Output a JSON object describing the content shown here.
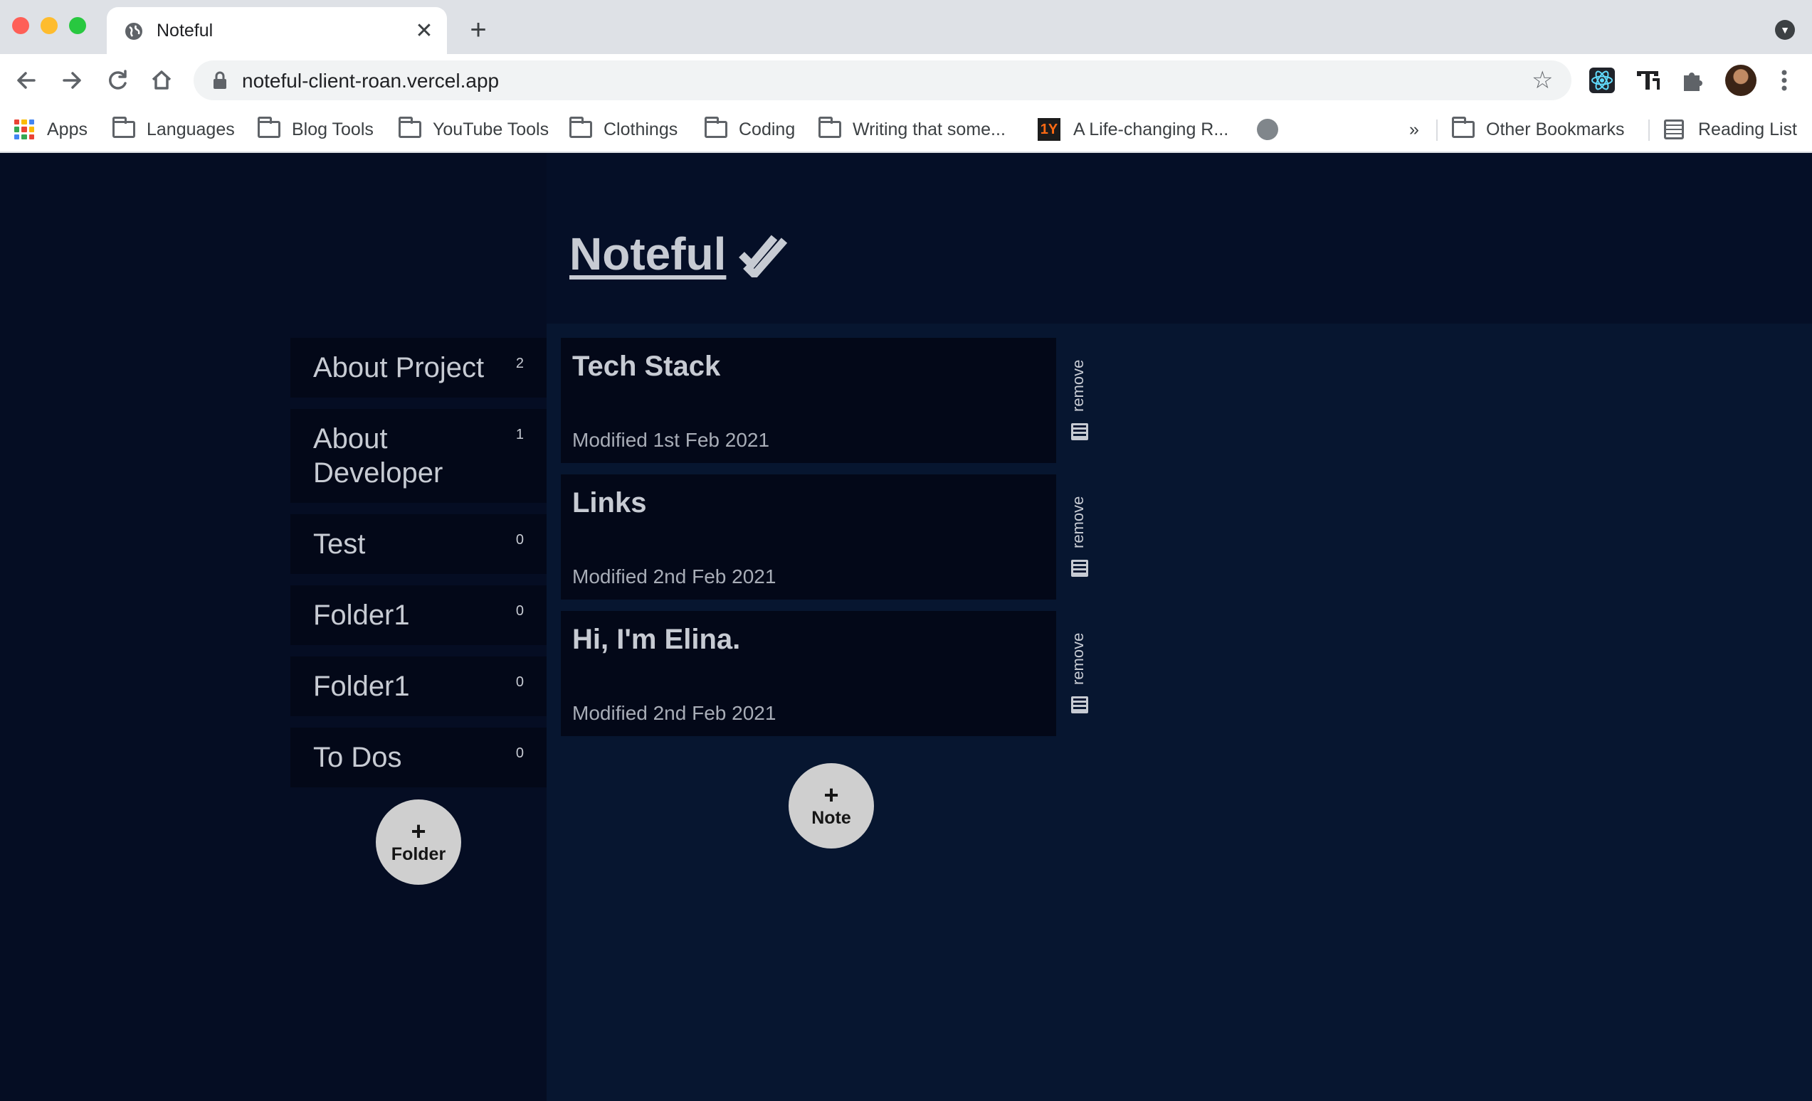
{
  "browser": {
    "tab_title": "Noteful",
    "tab_close": "✕",
    "new_tab": "+",
    "url": "noteful-client-roan.vercel.app",
    "icons": {
      "tab_favicon": "globe-icon",
      "back": "arrow-left-icon",
      "forward": "arrow-right-icon",
      "reload": "reload-icon",
      "home": "home-icon",
      "lock": "lock-icon",
      "bookmark_star": "star-icon",
      "react_devtools": "react-icon",
      "text_extension": "text-extension-icon",
      "extensions": "puzzle-icon",
      "profile": "avatar",
      "menu": "kebab-menu-icon"
    }
  },
  "bookmarks": {
    "items": [
      {
        "label": "Apps"
      },
      {
        "label": "Languages"
      },
      {
        "label": "Blog Tools"
      },
      {
        "label": "YouTube Tools"
      },
      {
        "label": "Clothings"
      },
      {
        "label": "Coding"
      },
      {
        "label": "Writing that some..."
      },
      {
        "label": "A Life-changing R..."
      }
    ],
    "overflow": "»",
    "other": "Other Bookmarks",
    "reading_list": "Reading List",
    "oneyear_badge": "1Y"
  },
  "app": {
    "title": "Noteful",
    "folders": [
      {
        "name": "About Project",
        "count": "2"
      },
      {
        "name": "About Developer",
        "count": "1"
      },
      {
        "name": "Test",
        "count": "0"
      },
      {
        "name": "Folder1",
        "count": "0"
      },
      {
        "name": "Folder1",
        "count": "0"
      },
      {
        "name": "To Dos",
        "count": "0"
      }
    ],
    "add_folder": {
      "plus": "+",
      "label": "Folder"
    },
    "notes": [
      {
        "title": "Tech Stack",
        "modified": "Modified 1st Feb 2021",
        "remove_label": "remove"
      },
      {
        "title": "Links",
        "modified": "Modified 2nd Feb 2021",
        "remove_label": "remove"
      },
      {
        "title": "Hi, I'm Elina.",
        "modified": "Modified 2nd Feb 2021",
        "remove_label": "remove"
      }
    ],
    "add_note": {
      "plus": "+",
      "label": "Note"
    }
  },
  "colors": {
    "page_bg": "#071630",
    "sidebar_bg": "#050d23",
    "card_bg": "#030818",
    "text": "#c7cbd3",
    "button_bg": "#cfcfcf"
  }
}
